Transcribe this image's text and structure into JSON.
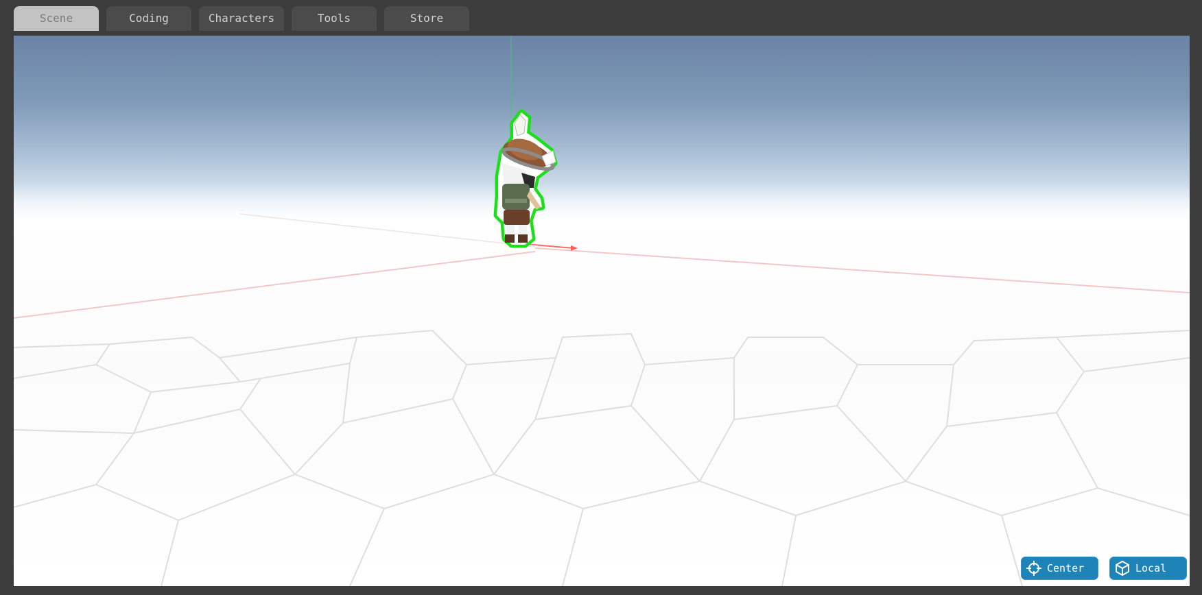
{
  "tabs": [
    {
      "label": "Scene",
      "active": true
    },
    {
      "label": "Coding",
      "active": false
    },
    {
      "label": "Characters",
      "active": false
    },
    {
      "label": "Tools",
      "active": false
    },
    {
      "label": "Store",
      "active": false
    }
  ],
  "viewport": {
    "selected_object": "character",
    "selection_outline_color": "#19e019",
    "buttons": {
      "center_label": "Center",
      "center_icon": "crosshair-icon",
      "local_label": "Local",
      "local_icon": "cube-icon"
    }
  },
  "colors": {
    "chrome": "#3c3c3c",
    "tab_active": "#c3c3c3",
    "tab_inactive": "#4b4b4b",
    "accent": "#1e84b8",
    "x_axis": "#e05050",
    "y_axis": "#2fae5a"
  }
}
